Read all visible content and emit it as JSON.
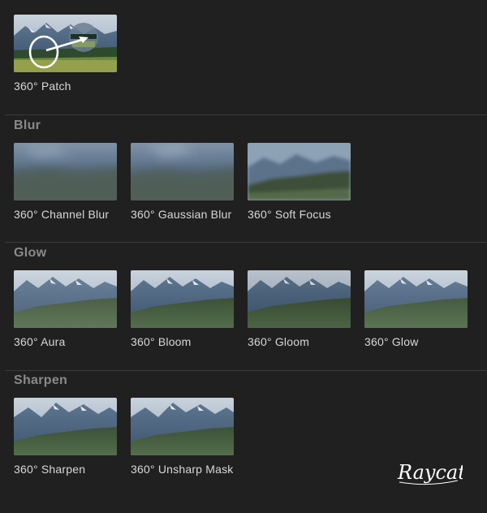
{
  "patch": {
    "label": "360° Patch"
  },
  "blur": {
    "title": "Blur",
    "items": [
      {
        "label": "360° Channel Blur",
        "icon": "blur-thumbnail"
      },
      {
        "label": "360° Gaussian Blur",
        "icon": "blur-thumbnail"
      },
      {
        "label": "360° Soft Focus",
        "icon": "soft-focus-thumbnail"
      }
    ]
  },
  "glow": {
    "title": "Glow",
    "items": [
      {
        "label": "360° Aura",
        "icon": "glow-thumbnail"
      },
      {
        "label": "360° Bloom",
        "icon": "glow-thumbnail"
      },
      {
        "label": "360° Gloom",
        "icon": "glow-thumbnail"
      },
      {
        "label": "360° Glow",
        "icon": "glow-thumbnail"
      }
    ]
  },
  "sharpen": {
    "title": "Sharpen",
    "items": [
      {
        "label": "360° Sharpen",
        "icon": "sharpen-thumbnail"
      },
      {
        "label": "360° Unsharp Mask",
        "icon": "sharpen-thumbnail"
      }
    ]
  },
  "watermark": {
    "text": "Raycat"
  },
  "colors": {
    "background": "#202020",
    "label": "#d8d8d8",
    "section_title": "#8a8a8a",
    "divider": "#3b3b3b"
  }
}
